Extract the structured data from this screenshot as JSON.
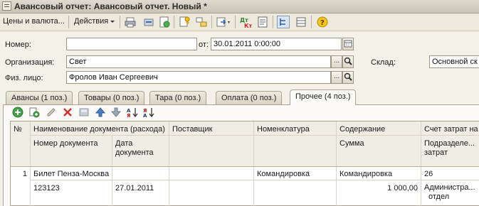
{
  "window": {
    "title": "Авансовый отчет: Авансовый отчет. Новый *"
  },
  "toolbar": {
    "prices_label": "Цены и валюта...",
    "actions_label": "Действия"
  },
  "form": {
    "number_label": "Номер:",
    "number_value": "",
    "from_label": "от:",
    "date_value": "30.01.2011  0:00:00",
    "org_label": "Организация:",
    "org_value": "Свет",
    "warehouse_label": "Склад:",
    "warehouse_value": "Основной ск",
    "person_label": "Физ. лицо:",
    "person_value": "Фролов Иван  Сергеевич",
    "select_glyph": "...",
    "search_glyph": "🔍"
  },
  "tabs": [
    {
      "label": "Авансы (1 поз.)",
      "active": false
    },
    {
      "label": "Товары (0 поз.)",
      "active": false
    },
    {
      "label": "Тара (0 поз.)",
      "active": false
    },
    {
      "label": "Оплата (0 поз.)",
      "active": false
    },
    {
      "label": "Прочее (4 поз.)",
      "active": true
    }
  ],
  "table": {
    "headers": {
      "num": "№",
      "doc_name": "Наименование документа (расхода)",
      "doc_number": "Номер документа",
      "doc_date_1": "Дата",
      "doc_date_2": "документа",
      "supplier": "Поставщик",
      "nomenclature": "Номенклатура",
      "content": "Содержание",
      "sum": "Сумма",
      "account": "Счет затрат на",
      "dept_1": "Подразделе...",
      "dept_2": "затрат"
    },
    "rows": [
      {
        "num": "1",
        "doc_name": "Билет Пенза-Москва",
        "doc_number": "123123",
        "doc_date": "27.01.2011",
        "supplier": "",
        "nomenclature": "Командировка",
        "content": "Командировка",
        "sum": "1 000,00",
        "account": "26",
        "dept_1": "Администра...",
        "dept_2": "отдел"
      }
    ]
  }
}
